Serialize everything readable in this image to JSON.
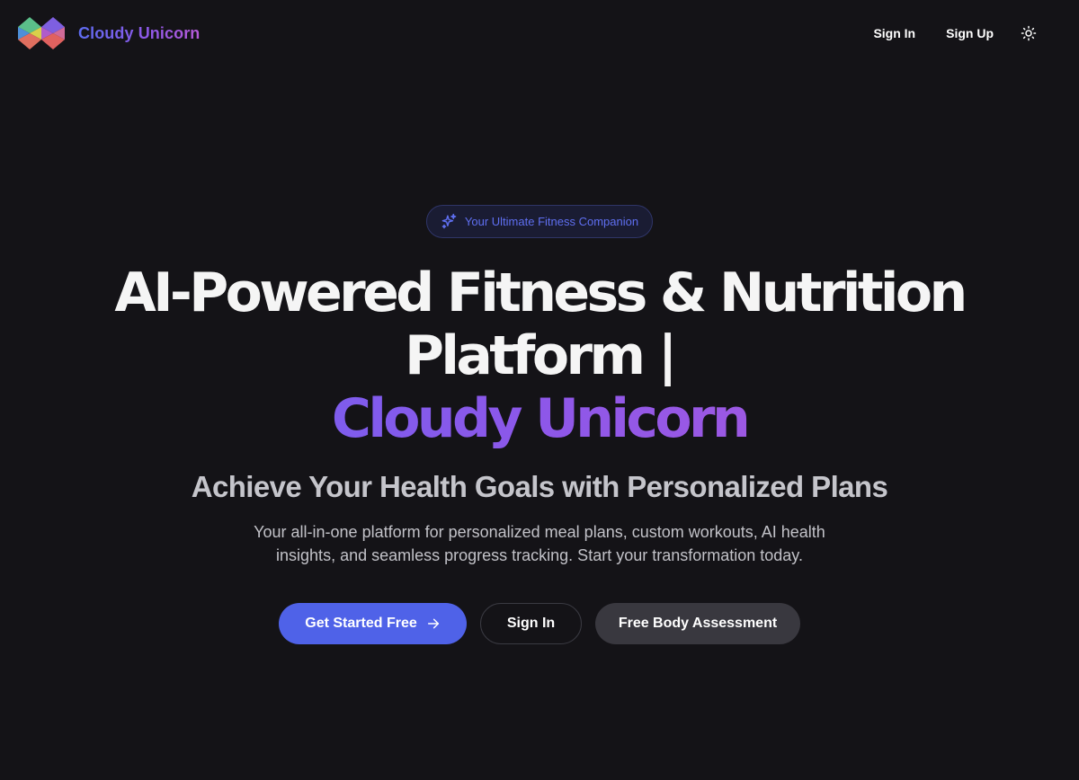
{
  "header": {
    "brand_name": "Cloudy Unicorn",
    "nav": {
      "sign_in": "Sign In",
      "sign_up": "Sign Up",
      "theme_toggle_icon": "sun-icon"
    }
  },
  "hero": {
    "badge": {
      "icon": "sparkles-icon",
      "text": "Your Ultimate Fitness Companion"
    },
    "title_line1": "AI-Powered Fitness & Nutrition",
    "title_line2": "Platform |",
    "title_accent": "Cloudy Unicorn",
    "subtitle": "Achieve Your Health Goals with Personalized Plans",
    "description_line1": "Your all-in-one platform for personalized meal plans, custom workouts, AI health",
    "description_line2": "insights, and seamless progress tracking. Start your transformation today.",
    "buttons": {
      "primary": "Get Started Free",
      "primary_icon": "arrow-right-icon",
      "secondary": "Sign In",
      "tertiary": "Free Body Assessment"
    }
  },
  "colors": {
    "background": "#141317",
    "accent": "#4f62e8",
    "gradient_start": "#6a63f1",
    "gradient_end": "#b15bdb"
  }
}
